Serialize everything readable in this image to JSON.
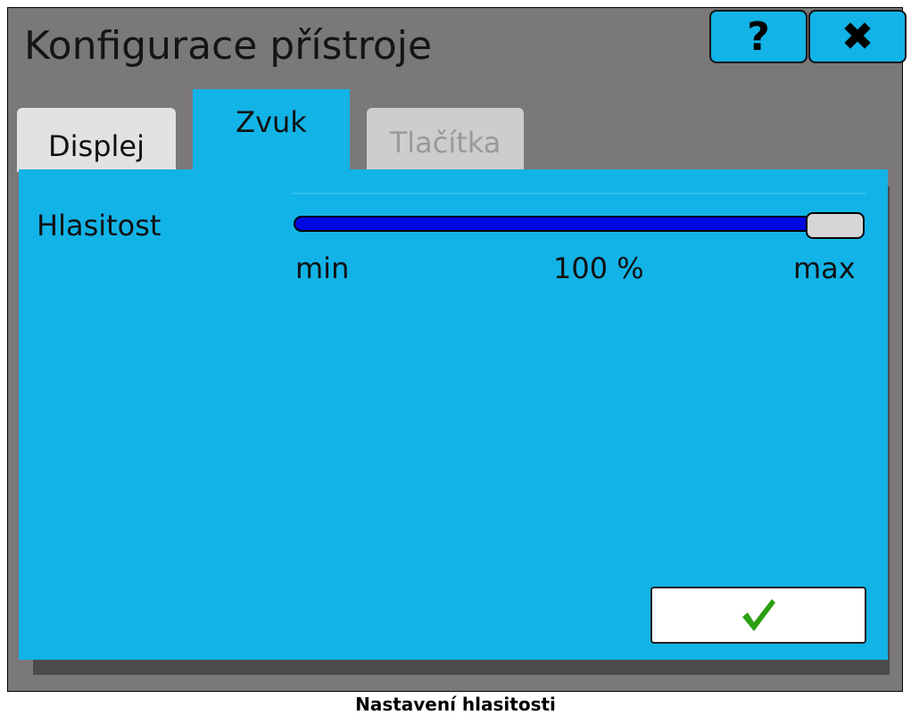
{
  "window": {
    "title": "Konfigurace přístroje",
    "help_label": "?",
    "close_label": "✖"
  },
  "tabs": [
    {
      "label": "Displej",
      "state": "inactive"
    },
    {
      "label": "Zvuk",
      "state": "active"
    },
    {
      "label": "Tlačítka",
      "state": "disabled"
    }
  ],
  "volume": {
    "label": "Hlasitost",
    "min_label": "min",
    "value_label": "100 %",
    "max_label": "max",
    "level_percent": 100
  },
  "ok_button": {
    "icon": "checkmark-icon",
    "color": "#2c9f10"
  },
  "caption": "Nastavení hlasitosti",
  "colors": {
    "accent": "#12b3e6",
    "frame": "#7a7879",
    "slider_fill": "#0008e0"
  }
}
